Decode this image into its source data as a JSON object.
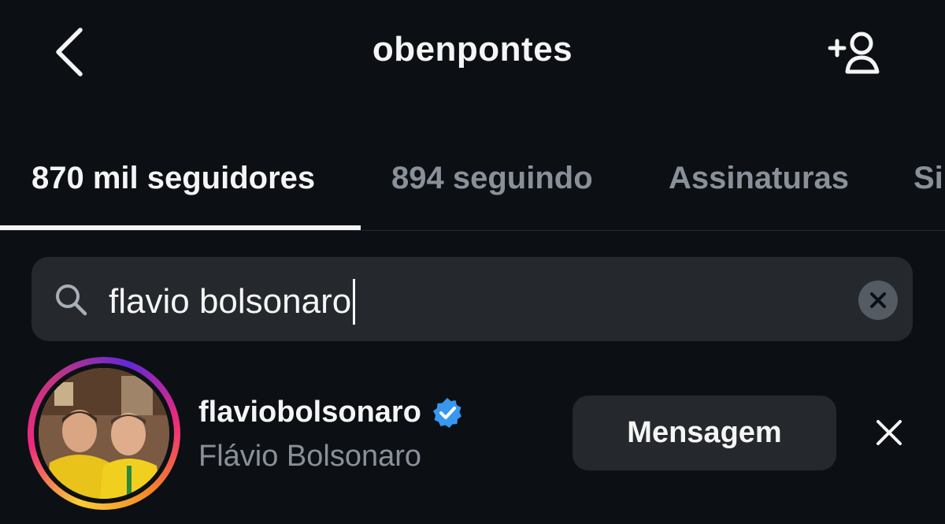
{
  "header": {
    "title": "obenpontes",
    "back_icon": "chevron-left-icon",
    "add_user_icon": "add-user-icon"
  },
  "tabs": [
    {
      "label": "870 mil seguidores",
      "active": true
    },
    {
      "label": "894 seguindo",
      "active": false
    },
    {
      "label": "Assinaturas",
      "active": false
    },
    {
      "label": "Si",
      "active": false
    }
  ],
  "search": {
    "value": "flavio bolsonaro",
    "icon": "search-icon",
    "clear_icon": "clear-icon"
  },
  "results": [
    {
      "username": "flaviobolsonaro",
      "full_name": "Flávio Bolsonaro",
      "verified": true,
      "has_story": true,
      "message_label": "Mensagem",
      "remove_icon": "close-icon"
    }
  ],
  "colors": {
    "background": "#0c1014",
    "surface": "#25292e",
    "text_primary": "#f5f5f5",
    "text_secondary": "#8a9099",
    "verified_blue": "#3897f0"
  }
}
